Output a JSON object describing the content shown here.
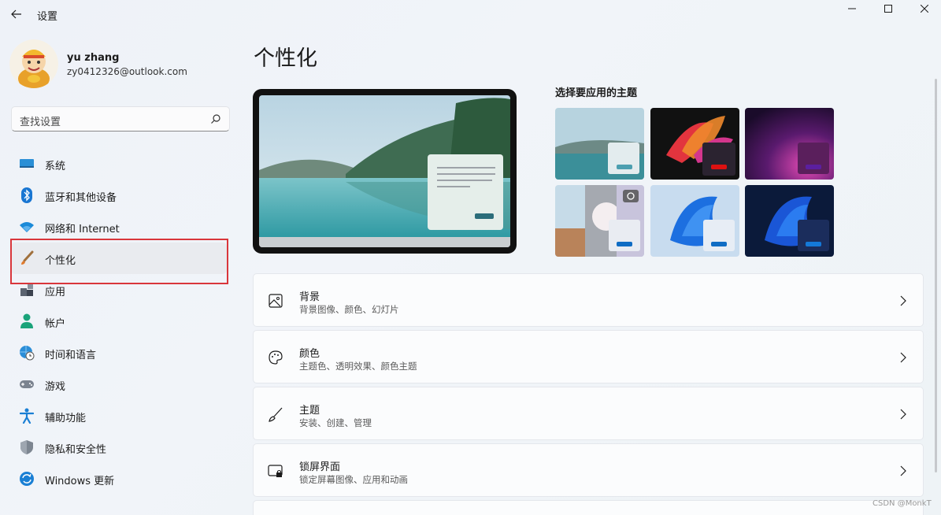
{
  "window": {
    "title": "设置"
  },
  "profile": {
    "name": "yu zhang",
    "email": "zy0412326@outlook.com"
  },
  "search": {
    "placeholder": "查找设置"
  },
  "nav": {
    "items": [
      {
        "label": "系统",
        "icon": "monitor-icon"
      },
      {
        "label": "蓝牙和其他设备",
        "icon": "bluetooth-icon"
      },
      {
        "label": "网络和 Internet",
        "icon": "wifi-icon"
      },
      {
        "label": "个性化",
        "icon": "brush-icon",
        "active": true
      },
      {
        "label": "应用",
        "icon": "apps-icon"
      },
      {
        "label": "帐户",
        "icon": "person-icon"
      },
      {
        "label": "时间和语言",
        "icon": "globe-clock-icon"
      },
      {
        "label": "游戏",
        "icon": "gamepad-icon"
      },
      {
        "label": "辅助功能",
        "icon": "accessibility-icon"
      },
      {
        "label": "隐私和安全性",
        "icon": "shield-icon"
      },
      {
        "label": "Windows 更新",
        "icon": "update-icon"
      }
    ]
  },
  "main": {
    "title": "个性化",
    "theme_heading": "选择要应用的主题",
    "cards": [
      {
        "title": "背景",
        "subtitle": "背景图像、颜色、幻灯片",
        "icon": "image-icon"
      },
      {
        "title": "颜色",
        "subtitle": "主题色、透明效果、颜色主题",
        "icon": "palette-icon"
      },
      {
        "title": "主题",
        "subtitle": "安装、创建、管理",
        "icon": "brush-icon"
      },
      {
        "title": "锁屏界面",
        "subtitle": "锁定屏幕图像、应用和动画",
        "icon": "lock-screen-icon"
      }
    ]
  },
  "watermark": "CSDN @MonkT",
  "colors": {
    "accent": "#0067c0",
    "highlight_border": "#d9363b"
  }
}
